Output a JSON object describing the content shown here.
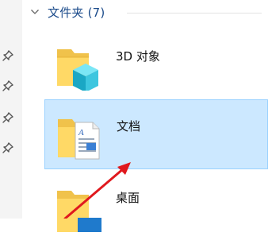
{
  "group": {
    "title": "文件夹 (7)"
  },
  "items": [
    {
      "label": "3D 对象",
      "icon": "folder-3d-objects-icon"
    },
    {
      "label": "文档",
      "icon": "folder-documents-icon",
      "selected": true
    },
    {
      "label": "桌面",
      "icon": "folder-desktop-icon"
    }
  ],
  "pins": [
    "pin-icon",
    "pin-icon",
    "pin-icon",
    "pin-icon"
  ],
  "colors": {
    "selection_bg": "#cce8ff",
    "selection_border": "#99d1ff",
    "annotation_arrow": "#e0191e",
    "group_title": "#1a4a8a"
  }
}
